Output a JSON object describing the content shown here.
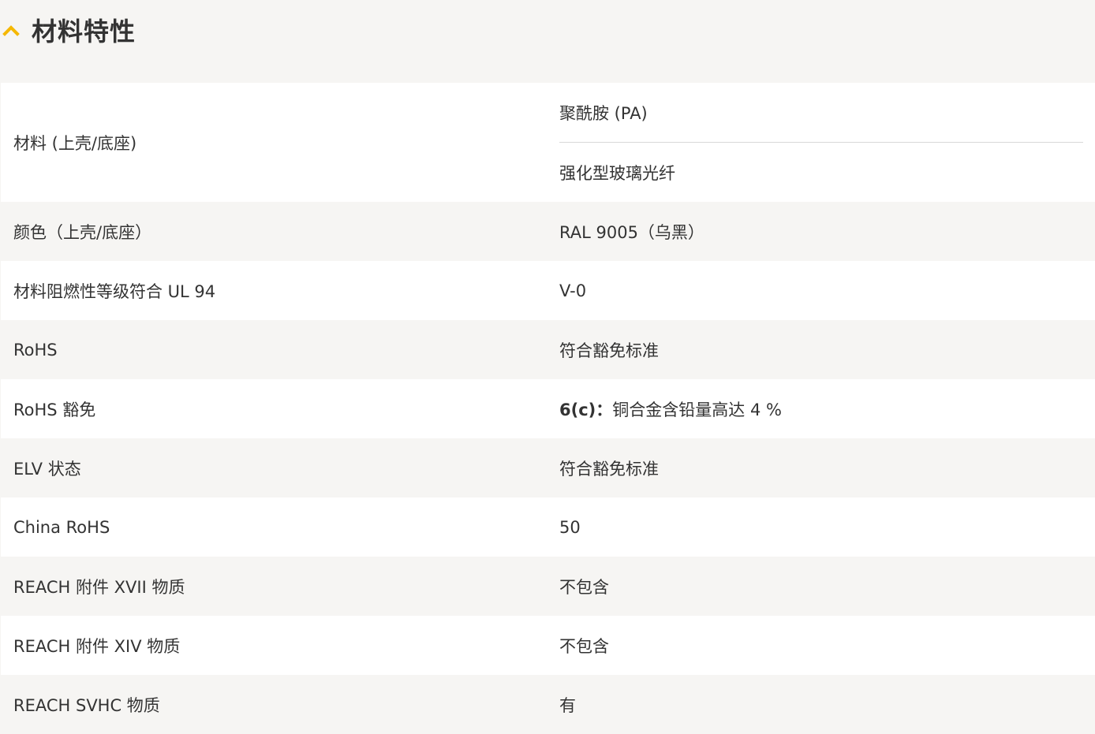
{
  "section": {
    "title": "材料特性",
    "chevron_icon": "chevron-up-icon",
    "accent_color": "#f5b800"
  },
  "rows": [
    {
      "label": "材料 (上壳/底座)",
      "values": [
        "聚酰胺 (PA)",
        "强化型玻璃光纤"
      ]
    },
    {
      "label": "颜色（上壳/底座）",
      "value": "RAL 9005（乌黑）"
    },
    {
      "label": "材料阻燃性等级符合 UL 94",
      "value": "V-0"
    },
    {
      "label": "RoHS",
      "value": "符合豁免标准"
    },
    {
      "label": "RoHS 豁免",
      "value_bold": "6(c)：",
      "value_rest": "铜合金含铅量高达 4 %"
    },
    {
      "label": "ELV 状态",
      "value": "符合豁免标准"
    },
    {
      "label": "China RoHS",
      "value": "50"
    },
    {
      "label": "REACH 附件 XVII 物质",
      "value": "不包含"
    },
    {
      "label": "REACH 附件 XIV 物质",
      "value": "不包含"
    },
    {
      "label": "REACH SVHC 物质",
      "value": "有"
    }
  ]
}
